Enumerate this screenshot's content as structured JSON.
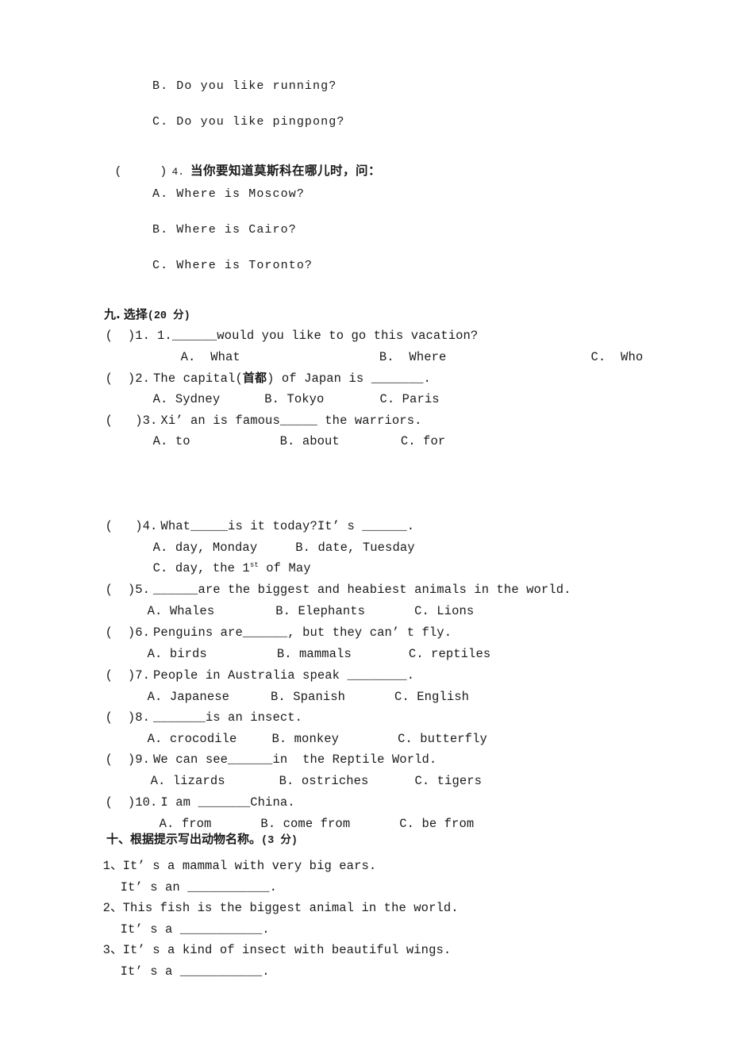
{
  "document": {
    "type": "english-exam-worksheet",
    "page_background": "#ffffff",
    "text_color": "#1a1a1a"
  },
  "carryover_options": {
    "option_b": "B. Do you like running?",
    "option_c": "C. Do you like pingpong?"
  },
  "question_four_cn": {
    "bracket": "(",
    "bracket_close": ")",
    "number": "4.",
    "prompt": "当你要知道莫斯科在哪儿时，问：",
    "options": [
      "A. Where is Moscow?",
      "B. Where is Cairo?",
      "C. Where is Toronto?"
    ]
  },
  "section_nine": {
    "index": "九.",
    "title": "选择",
    "points": "(20 分)",
    "questions": [
      {
        "marker": "(  )1.",
        "stem_pre": "1.",
        "blank": "______",
        "stem_post": "would you like to go this vacation?",
        "options": [
          "A.  What",
          "B.  Where",
          "C.  Who"
        ],
        "option_layout": "wide"
      },
      {
        "marker": "(  )2.",
        "stem_pre": "The capital(",
        "stem_cn": "首都",
        "stem_mid": ") of Japan is ",
        "blank": "_______",
        "stem_post": ".",
        "options": [
          "A. Sydney",
          "B. Tokyo",
          "C. Paris"
        ]
      },
      {
        "marker": "(   )3.",
        "stem_pre": "Xi’ an is famous",
        "blank": "_____",
        "stem_post": " the warriors.",
        "options": [
          "A. to",
          "B. about",
          "C. for"
        ]
      },
      {
        "marker": "(   )4.",
        "stem_pre": "What",
        "blank": "_____",
        "stem_post": "is it today?It’ s ",
        "blank2": "______",
        "stem_end": ".",
        "options_line1": [
          "A. day, Monday",
          "B. date, Tuesday"
        ],
        "options_line2_pre": "C. day, the 1",
        "options_line2_sup": "st",
        "options_line2_post": " of May"
      },
      {
        "marker": "(  )5.",
        "stem_pre": "",
        "blank": "______",
        "stem_post": "are the biggest and heabiest animals in the world.",
        "options": [
          "A. Whales",
          "B. Elephants",
          "C. Lions"
        ]
      },
      {
        "marker": "(  )6.",
        "stem_pre": "Penguins are",
        "blank": "______",
        "stem_post": ", but they can’ t fly.",
        "options": [
          "A. birds",
          "B. mammals",
          "C. reptiles"
        ]
      },
      {
        "marker": "(  )7.",
        "stem_pre": "People in Australia speak ",
        "blank": "________",
        "stem_post": ".",
        "options": [
          "A. Japanese",
          "B. Spanish",
          "C. English"
        ]
      },
      {
        "marker": "(  )8.",
        "stem_pre": "",
        "blank": "_______",
        "stem_post": "is an insect.",
        "options": [
          "A. crocodile",
          "B. monkey",
          "C. butterfly"
        ]
      },
      {
        "marker": "(  )9.",
        "stem_pre": "We can see",
        "blank": "______",
        "stem_post": "in  the Reptile World.",
        "options": [
          "A. lizards",
          "B. ostriches",
          "C. tigers"
        ]
      },
      {
        "marker": "(  )10.",
        "stem_pre": "I am ",
        "blank": "_______",
        "stem_post": "China.",
        "options": [
          "A. from",
          "B. come from",
          "C. be from"
        ]
      }
    ]
  },
  "section_ten": {
    "index": "十、",
    "title": "根据提示写出动物名称。",
    "points": "(3 分)",
    "items": [
      {
        "number": "1、",
        "clue": "It’ s a mammal with very big ears.",
        "answer_pre": "It’ s an ",
        "answer_blank": "___________",
        "answer_post": "."
      },
      {
        "number": "2、",
        "clue": "This fish is the biggest animal in the world.",
        "answer_pre": "It’ s a ",
        "answer_blank": "___________",
        "answer_post": "."
      },
      {
        "number": "3、",
        "clue": "It’ s a kind of insect with beautiful wings.",
        "answer_pre": "It’ s a ",
        "answer_blank": "___________",
        "answer_post": "."
      }
    ]
  }
}
